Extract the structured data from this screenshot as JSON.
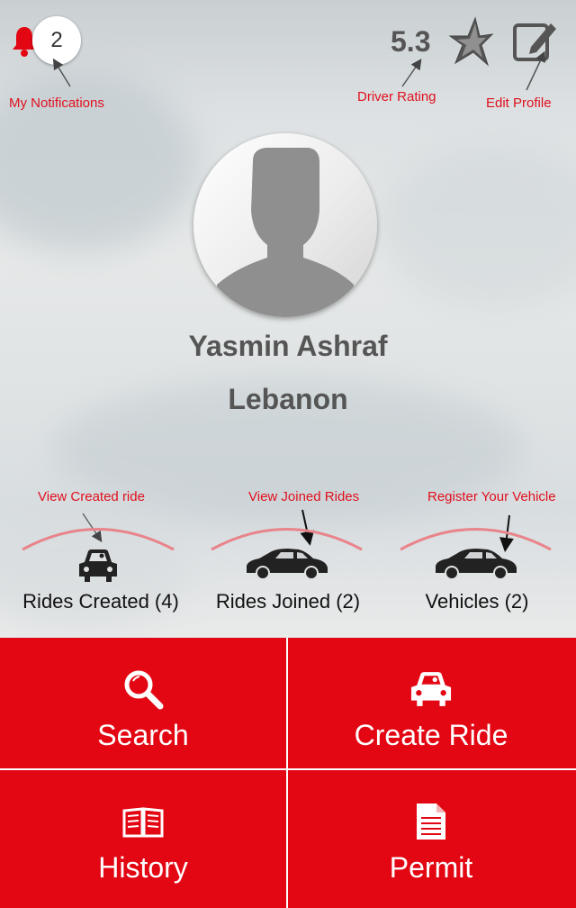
{
  "header": {
    "notification_count": "2",
    "rating": "5.3"
  },
  "annotations": {
    "my_notifications": "My Notifications",
    "driver_rating": "Driver Rating",
    "edit_profile": "Edit Profile",
    "view_created": "View Created ride",
    "view_joined": "View Joined Rides",
    "register_vehicle": "Register Your Vehicle"
  },
  "profile": {
    "name": "Yasmin Ashraf",
    "country": "Lebanon"
  },
  "stats": {
    "rides_created": "Rides Created (4)",
    "rides_joined": "Rides Joined (2)",
    "vehicles": "Vehicles (2)"
  },
  "menu": {
    "search": "Search",
    "create_ride": "Create Ride",
    "history": "History",
    "permit": "Permit"
  },
  "colors": {
    "accent": "#e30613",
    "annotation": "#e0101e"
  }
}
